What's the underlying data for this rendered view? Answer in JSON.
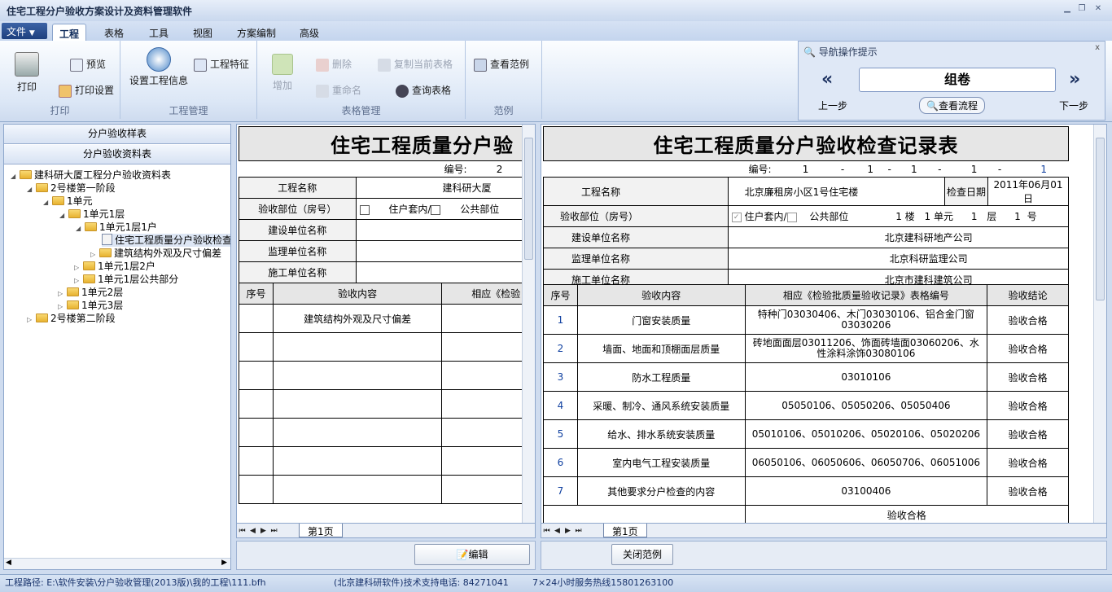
{
  "app": {
    "title": "住宅工程分户验收方案设计及资料管理软件"
  },
  "menu": {
    "file": "文件",
    "tabs": [
      "工程",
      "表格",
      "工具",
      "视图",
      "方案编制",
      "高级"
    ]
  },
  "ribbon": {
    "print": "打印",
    "preview": "预览",
    "print_setup": "打印设置",
    "group_print": "打印",
    "project_info": "设置工程信息",
    "project_feature": "工程特征",
    "group_project": "工程管理",
    "add": "增加",
    "delete": "删除",
    "rename": "重命名",
    "copy_table": "复制当前表格",
    "query_table": "查询表格",
    "group_table": "表格管理",
    "view_sample": "查看范例",
    "group_sample": "范例"
  },
  "nav": {
    "title": "导航操作提示",
    "current": "组卷",
    "prev": "上一步",
    "next": "下一步",
    "view_flow": "查看流程"
  },
  "left": {
    "btn_samples": "分户验收样表",
    "btn_data": "分户验收资料表",
    "tree": [
      "建科研大厦工程分户验收资料表",
      "2号楼第一阶段",
      "1单元",
      "1单元1层",
      "1单元1层1户",
      "住宅工程质量分户验收检查",
      "建筑结构外观及尺寸偏差",
      "1单元1层2户",
      "1单元1层公共部分",
      "1单元2层",
      "1单元3层",
      "2号楼第二阶段"
    ]
  },
  "mid": {
    "title": "住宅工程质量分户验",
    "no_label": "编号:",
    "no": "2",
    "project_name_label": "工程名称",
    "project_name": "建科研大厦",
    "part_label": "验收部位（房号）",
    "household": "住户套内/",
    "public": "公共部位",
    "builder_label": "建设单位名称",
    "supervisor_label": "监理单位名称",
    "constructor_label": "施工单位名称",
    "col_seq": "序号",
    "col_content": "验收内容",
    "col_ref": "相应《检验",
    "row1": "建筑结构外观及尺寸偏差",
    "sheet_tab": "第1页",
    "edit": "编辑"
  },
  "right": {
    "title": "住宅工程质量分户验收检查记录表",
    "no_label": "编号:",
    "no_parts": [
      "1",
      "1",
      "1",
      "1",
      "1"
    ],
    "project_name_label": "工程名称",
    "project_name": "北京廉租房小区1号住宅楼",
    "date_label": "检查日期",
    "date": "2011年06月01日",
    "part_label": "验收部位（房号）",
    "household": "住户套内/",
    "public": "公共部位",
    "building_no": "1",
    "building_label": "楼",
    "unit_no": "1",
    "unit_label": "单元",
    "floor_no": "1",
    "floor_label": "层",
    "room_no": "1",
    "room_label": "号",
    "builder_label": "建设单位名称",
    "builder": "北京建科研地产公司",
    "supervisor_label": "监理单位名称",
    "supervisor": "北京科研监理公司",
    "constructor_label": "施工单位名称",
    "constructor": "北京市建科建筑公司",
    "col_seq": "序号",
    "col_content": "验收内容",
    "col_ref": "相应《检验批质量验收记录》表格编号",
    "col_result": "验收结论",
    "rows": [
      {
        "seq": "1",
        "content": "门窗安装质量",
        "ref": "特种门03030406、木门03030106、铝合金门窗03030206",
        "result": "验收合格"
      },
      {
        "seq": "2",
        "content": "墙面、地面和顶棚面层质量",
        "ref": "砖地面面层03011206、饰面砖墙面03060206、水性涂料涂饰03080106",
        "result": "验收合格"
      },
      {
        "seq": "3",
        "content": "防水工程质量",
        "ref": "03010106",
        "result": "验收合格"
      },
      {
        "seq": "4",
        "content": "采暖、制冷、通风系统安装质量",
        "ref": "05050106、05050206、05050406",
        "result": "验收合格"
      },
      {
        "seq": "5",
        "content": "给水、排水系统安装质量",
        "ref": "05010106、05010206、05020106、05020206",
        "result": "验收合格"
      },
      {
        "seq": "6",
        "content": "室内电气工程安装质量",
        "ref": "06050106、06050606、06050706、06051006",
        "result": "验收合格"
      },
      {
        "seq": "7",
        "content": "其他要求分户检查的内容",
        "ref": "03100406",
        "result": "验收合格"
      }
    ],
    "final_result": "验收合格",
    "sheet_tab": "第1页",
    "close_sample": "关闭范例"
  },
  "status": {
    "path": "工程路径: E:\\软件安装\\分户验收管理(2013版)\\我的工程\\111.bfh",
    "support": "(北京建科研软件)技术支持电话: 84271041",
    "hotline": "7×24小时服务热线15801263100"
  }
}
